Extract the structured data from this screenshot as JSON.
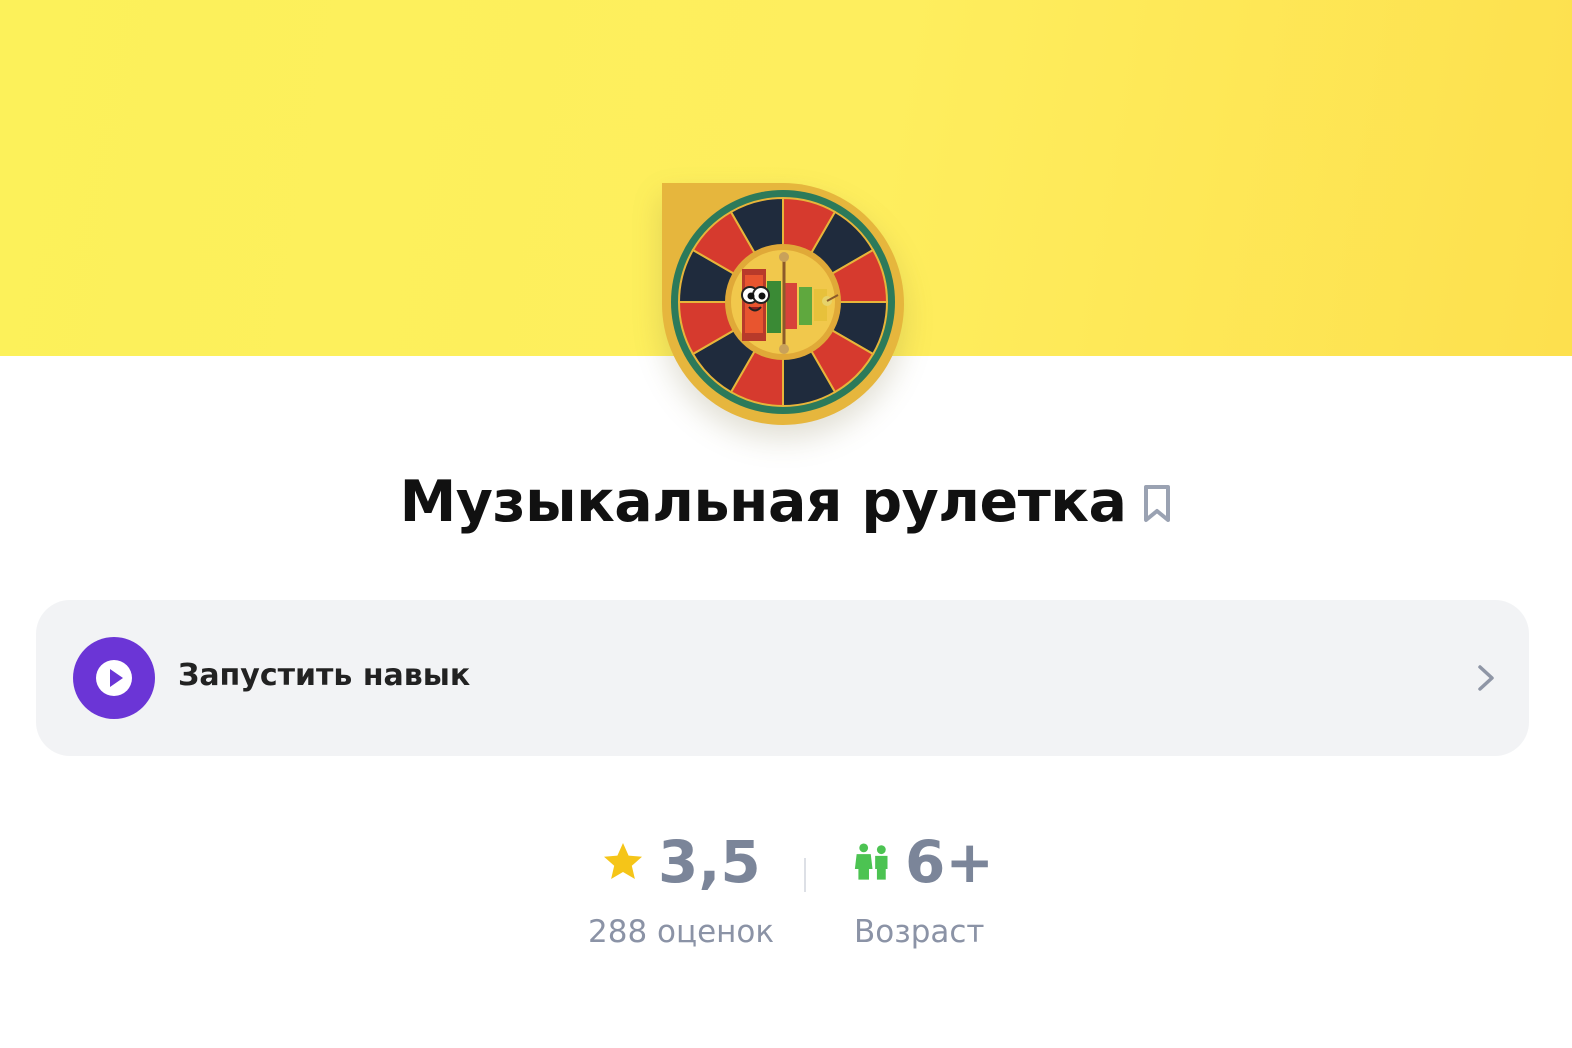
{
  "skill": {
    "title": "Музыкальная рулетка",
    "launch_label": "Запустить навык"
  },
  "stats": {
    "rating_value": "3,5",
    "rating_count_label": "288 оценок",
    "age_value": "6+",
    "age_label": "Возраст"
  },
  "icons": {
    "bookmark": "bookmark-icon",
    "play": "play-icon",
    "chevron": "chevron-right-icon",
    "star": "star-icon",
    "kids": "kids-icon"
  },
  "colors": {
    "hero_yellow": "#fcf15a",
    "accent_purple": "#6b35d6",
    "star_yellow": "#f5c518",
    "kids_green": "#4cc352",
    "stat_gray": "#7b8599"
  }
}
